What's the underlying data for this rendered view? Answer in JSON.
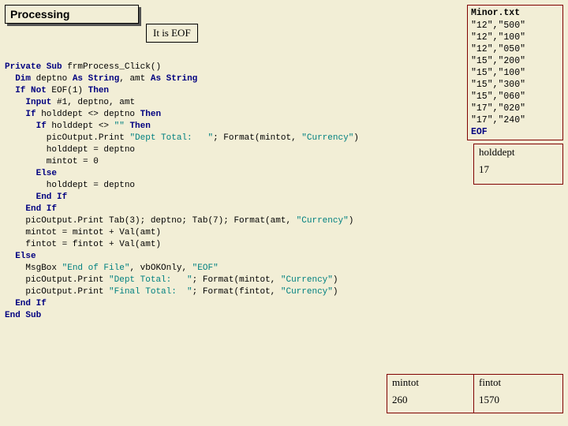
{
  "title": "Processing",
  "eof_note": "It is EOF",
  "file": {
    "name": "Minor.txt",
    "rows": [
      "\"12\",\"500\"",
      "\"12\",\"100\"",
      "\"12\",\"050\"",
      "\"15\",\"200\"",
      "\"15\",\"100\"",
      "\"15\",\"300\"",
      "\"15\",\"060\"",
      "\"17\",\"020\"",
      "\"17\",\"240\""
    ],
    "eof": "EOF"
  },
  "vars": {
    "holddept_label": "holddept",
    "holddept_value": "17",
    "mintot_label": "mintot",
    "mintot_value": "260",
    "fintot_label": "fintot",
    "fintot_value": "1570"
  },
  "code": {
    "l1a": "Private Sub",
    "l1b": " frmProcess_Click()",
    "l2a": "  Dim",
    "l2b": " deptno ",
    "l2c": "As String",
    "l2d": ", amt ",
    "l2e": "As String",
    "l3a": "  If Not",
    "l3b": " EOF(1) ",
    "l3c": "Then",
    "l4a": "    Input",
    "l4b": " #1, deptno, amt",
    "l5a": "    If",
    "l5b": " holddept <> deptno ",
    "l5c": "Then",
    "l6a": "      If",
    "l6b": " holddept <> ",
    "l6c": "\"\"",
    "l6d": " ",
    "l6e": "Then",
    "l7a": "        picOutput.Print ",
    "l7b": "\"Dept Total:   \"",
    "l7c": "; Format(mintot, ",
    "l7d": "\"Currency\"",
    "l7e": ")",
    "l8": "        holddept = deptno",
    "l9": "        mintot = 0",
    "l10": "      Else",
    "l11": "        holddept = deptno",
    "l12": "      End If",
    "l13": "    End If",
    "l14a": "    picOutput.Print Tab(3); deptno; Tab(7); Format(amt, ",
    "l14b": "\"Currency\"",
    "l14c": ")",
    "l15": "    mintot = mintot + Val(amt)",
    "l16": "    fintot = fintot + Val(amt)",
    "l17": "  Else",
    "l18a": "    MsgBox ",
    "l18b": "\"End of File\"",
    "l18c": ", vbOKOnly, ",
    "l18d": "\"EOF\"",
    "l19a": "    picOutput.Print ",
    "l19b": "\"Dept Total:   \"",
    "l19c": "; Format(mintot, ",
    "l19d": "\"Currency\"",
    "l19e": ")",
    "l20a": "    picOutput.Print ",
    "l20b": "\"Final Total:  \"",
    "l20c": "; Format(fintot, ",
    "l20d": "\"Currency\"",
    "l20e": ")",
    "l21": "  End If",
    "l22": "End Sub"
  }
}
